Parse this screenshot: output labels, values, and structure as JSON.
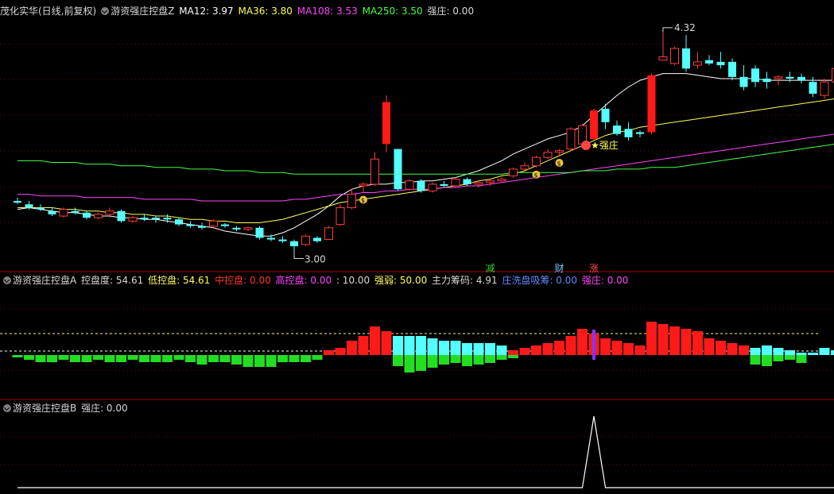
{
  "panel1": {
    "stock_title": "茂化实华(日线,前复权)",
    "indicator_name": "游资强庄控盘Z",
    "ma": [
      {
        "label": "MA12: 3.97",
        "color": "#ffffff"
      },
      {
        "label": "MA36: 3.80",
        "color": "#ffff55"
      },
      {
        "label": "MA108: 3.53",
        "color": "#ff44ff"
      },
      {
        "label": "MA250: 3.50",
        "color": "#44ff44"
      },
      {
        "label": "强庄: 0.00",
        "color": "#d8d8d8"
      }
    ],
    "high_label": "4.32",
    "low_label": "3.00",
    "star_label": "★强庄",
    "signals": [
      {
        "text": "减",
        "color": "#33cc33"
      },
      {
        "text": "财",
        "color": "#66ccff"
      },
      {
        "text": "涨",
        "color": "#ff4444"
      }
    ]
  },
  "panel2": {
    "indicator_name": "游资强庄控盘A",
    "items": [
      {
        "label": "控盘度: 54.61",
        "color": "#d8d8d8"
      },
      {
        "label": "低控盘: 54.61",
        "color": "#ffff55"
      },
      {
        "label": "中控盘: 0.00",
        "color": "#ff3333"
      },
      {
        "label": "高控盘: 0.00",
        "color": "#ff44ff"
      },
      {
        "label": ": 10.00",
        "color": "#d8d8d8"
      },
      {
        "label": "强弱: 50.00",
        "color": "#ffff55"
      },
      {
        "label": "主力筹码: 4.91",
        "color": "#d8d8d8"
      },
      {
        "label": "庄洗盘吸筹: 0.00",
        "color": "#6688ff"
      },
      {
        "label": "强庄: 0.00",
        "color": "#ff44ff"
      }
    ]
  },
  "panel3": {
    "indicator_name": "游资强庄控盘B",
    "items": [
      {
        "label": "强庄: 0.00",
        "color": "#d8d8d8"
      }
    ]
  },
  "chart_data": {
    "type": "candlestick",
    "price_range": [
      2.95,
      4.4
    ],
    "candles": [
      {
        "o": 3.31,
        "h": 3.33,
        "l": 3.29,
        "c": 3.3
      },
      {
        "o": 3.29,
        "h": 3.31,
        "l": 3.26,
        "c": 3.27
      },
      {
        "o": 3.27,
        "h": 3.29,
        "l": 3.25,
        "c": 3.26
      },
      {
        "o": 3.25,
        "h": 3.27,
        "l": 3.22,
        "c": 3.23
      },
      {
        "o": 3.22,
        "h": 3.27,
        "l": 3.21,
        "c": 3.26
      },
      {
        "o": 3.25,
        "h": 3.27,
        "l": 3.23,
        "c": 3.24
      },
      {
        "o": 3.24,
        "h": 3.25,
        "l": 3.2,
        "c": 3.21
      },
      {
        "o": 3.21,
        "h": 3.24,
        "l": 3.2,
        "c": 3.23
      },
      {
        "o": 3.23,
        "h": 3.27,
        "l": 3.21,
        "c": 3.25
      },
      {
        "o": 3.25,
        "h": 3.26,
        "l": 3.18,
        "c": 3.19
      },
      {
        "o": 3.19,
        "h": 3.22,
        "l": 3.18,
        "c": 3.21
      },
      {
        "o": 3.21,
        "h": 3.23,
        "l": 3.19,
        "c": 3.2
      },
      {
        "o": 3.21,
        "h": 3.22,
        "l": 3.18,
        "c": 3.2
      },
      {
        "o": 3.21,
        "h": 3.23,
        "l": 3.18,
        "c": 3.2
      },
      {
        "o": 3.2,
        "h": 3.21,
        "l": 3.16,
        "c": 3.17
      },
      {
        "o": 3.17,
        "h": 3.19,
        "l": 3.15,
        "c": 3.16
      },
      {
        "o": 3.16,
        "h": 3.18,
        "l": 3.14,
        "c": 3.15
      },
      {
        "o": 3.16,
        "h": 3.2,
        "l": 3.15,
        "c": 3.19
      },
      {
        "o": 3.17,
        "h": 3.18,
        "l": 3.15,
        "c": 3.16
      },
      {
        "o": 3.15,
        "h": 3.16,
        "l": 3.13,
        "c": 3.14
      },
      {
        "o": 3.14,
        "h": 3.16,
        "l": 3.13,
        "c": 3.15
      },
      {
        "o": 3.15,
        "h": 3.16,
        "l": 3.08,
        "c": 3.09
      },
      {
        "o": 3.09,
        "h": 3.11,
        "l": 3.07,
        "c": 3.08
      },
      {
        "o": 3.08,
        "h": 3.1,
        "l": 3.06,
        "c": 3.07
      },
      {
        "o": 3.07,
        "h": 3.08,
        "l": 3.0,
        "c": 3.04
      },
      {
        "o": 3.05,
        "h": 3.11,
        "l": 3.04,
        "c": 3.1
      },
      {
        "o": 3.09,
        "h": 3.1,
        "l": 3.06,
        "c": 3.07
      },
      {
        "o": 3.08,
        "h": 3.16,
        "l": 3.08,
        "c": 3.15
      },
      {
        "o": 3.17,
        "h": 3.29,
        "l": 3.16,
        "c": 3.27
      },
      {
        "o": 3.27,
        "h": 3.38,
        "l": 3.26,
        "c": 3.35
      },
      {
        "o": 3.4,
        "h": 3.42,
        "l": 3.36,
        "c": 3.41
      },
      {
        "o": 3.41,
        "h": 3.6,
        "l": 3.4,
        "c": 3.56
      },
      {
        "o": 3.65,
        "h": 3.94,
        "l": 3.6,
        "c": 3.9
      },
      {
        "o": 3.62,
        "h": 3.62,
        "l": 3.37,
        "c": 3.38
      },
      {
        "o": 3.38,
        "h": 3.44,
        "l": 3.37,
        "c": 3.43
      },
      {
        "o": 3.43,
        "h": 3.44,
        "l": 3.36,
        "c": 3.37
      },
      {
        "o": 3.37,
        "h": 3.42,
        "l": 3.36,
        "c": 3.41
      },
      {
        "o": 3.41,
        "h": 3.43,
        "l": 3.39,
        "c": 3.4
      },
      {
        "o": 3.4,
        "h": 3.45,
        "l": 3.39,
        "c": 3.44
      },
      {
        "o": 3.44,
        "h": 3.45,
        "l": 3.4,
        "c": 3.41
      },
      {
        "o": 3.41,
        "h": 3.43,
        "l": 3.39,
        "c": 3.42
      },
      {
        "o": 3.42,
        "h": 3.44,
        "l": 3.4,
        "c": 3.43
      },
      {
        "o": 3.43,
        "h": 3.45,
        "l": 3.42,
        "c": 3.44
      },
      {
        "o": 3.46,
        "h": 3.51,
        "l": 3.45,
        "c": 3.5
      },
      {
        "o": 3.5,
        "h": 3.54,
        "l": 3.49,
        "c": 3.52
      },
      {
        "o": 3.52,
        "h": 3.58,
        "l": 3.51,
        "c": 3.57
      },
      {
        "o": 3.57,
        "h": 3.62,
        "l": 3.56,
        "c": 3.6
      },
      {
        "o": 3.6,
        "h": 3.62,
        "l": 3.58,
        "c": 3.61
      },
      {
        "o": 3.62,
        "h": 3.75,
        "l": 3.61,
        "c": 3.74
      },
      {
        "o": 3.65,
        "h": 3.77,
        "l": 3.64,
        "c": 3.76
      },
      {
        "o": 3.68,
        "h": 3.86,
        "l": 3.67,
        "c": 3.85
      },
      {
        "o": 3.86,
        "h": 3.89,
        "l": 3.74,
        "c": 3.78
      },
      {
        "o": 3.76,
        "h": 3.79,
        "l": 3.7,
        "c": 3.71
      },
      {
        "o": 3.74,
        "h": 3.78,
        "l": 3.67,
        "c": 3.69
      },
      {
        "o": 3.72,
        "h": 3.73,
        "l": 3.69,
        "c": 3.71
      },
      {
        "o": 3.72,
        "h": 4.07,
        "l": 3.71,
        "c": 4.06
      },
      {
        "o": 4.15,
        "h": 4.32,
        "l": 4.15,
        "c": 4.17
      },
      {
        "o": 4.13,
        "h": 4.23,
        "l": 4.12,
        "c": 4.22
      },
      {
        "o": 4.22,
        "h": 4.3,
        "l": 4.08,
        "c": 4.1
      },
      {
        "o": 4.12,
        "h": 4.2,
        "l": 4.1,
        "c": 4.14
      },
      {
        "o": 4.15,
        "h": 4.18,
        "l": 4.12,
        "c": 4.13
      },
      {
        "o": 4.14,
        "h": 4.2,
        "l": 4.1,
        "c": 4.12
      },
      {
        "o": 4.14,
        "h": 4.16,
        "l": 4.03,
        "c": 4.05
      },
      {
        "o": 4.05,
        "h": 4.12,
        "l": 3.97,
        "c": 3.99
      },
      {
        "o": 4.1,
        "h": 4.12,
        "l": 3.99,
        "c": 4.02
      },
      {
        "o": 4.04,
        "h": 4.08,
        "l": 3.98,
        "c": 4.02
      },
      {
        "o": 4.04,
        "h": 4.06,
        "l": 4.0,
        "c": 4.05
      },
      {
        "o": 4.05,
        "h": 4.08,
        "l": 4.02,
        "c": 4.04
      },
      {
        "o": 4.05,
        "h": 4.07,
        "l": 4.01,
        "c": 4.03
      },
      {
        "o": 4.02,
        "h": 4.05,
        "l": 3.93,
        "c": 3.95
      },
      {
        "o": 3.94,
        "h": 4.04,
        "l": 3.92,
        "c": 4.02
      },
      {
        "o": 4.02,
        "h": 4.11,
        "l": 4.01,
        "c": 4.1
      },
      {
        "o": 4.04,
        "h": 4.11,
        "l": 4.01,
        "c": 4.1
      },
      {
        "o": 4.04,
        "h": 4.07,
        "l": 4.02,
        "c": 4.05
      },
      {
        "o": 4.05,
        "h": 4.09,
        "l": 4.03,
        "c": 4.08
      }
    ],
    "ma_lines": [
      {
        "name": "MA12",
        "color": "#ffffff",
        "values": [
          3.26,
          3.27,
          3.26,
          3.25,
          3.24,
          3.24,
          3.23,
          3.22,
          3.22,
          3.21,
          3.21,
          3.2,
          3.2,
          3.19,
          3.18,
          3.17,
          3.16,
          3.15,
          3.13,
          3.12,
          3.11,
          3.1,
          3.1,
          3.12,
          3.15,
          3.19,
          3.23,
          3.28,
          3.34,
          3.38,
          3.4,
          3.41,
          3.41,
          3.42,
          3.42,
          3.43,
          3.43,
          3.44,
          3.45,
          3.47,
          3.49,
          3.52,
          3.55,
          3.59,
          3.62,
          3.65,
          3.68,
          3.7,
          3.72,
          3.76,
          3.82,
          3.88,
          3.94,
          3.99,
          4.03,
          4.05,
          4.07,
          4.07,
          4.07,
          4.06,
          4.05,
          4.04,
          4.04,
          4.04,
          4.04,
          4.03,
          4.03,
          4.03,
          4.03,
          4.03,
          4.03,
          4.03,
          4.04
        ]
      },
      {
        "name": "MA36",
        "color": "#ffff55",
        "values": [
          3.27,
          3.27,
          3.27,
          3.27,
          3.26,
          3.26,
          3.25,
          3.25,
          3.24,
          3.24,
          3.23,
          3.23,
          3.22,
          3.22,
          3.21,
          3.2,
          3.2,
          3.19,
          3.19,
          3.18,
          3.18,
          3.18,
          3.19,
          3.2,
          3.22,
          3.24,
          3.26,
          3.28,
          3.3,
          3.31,
          3.32,
          3.33,
          3.34,
          3.35,
          3.36,
          3.37,
          3.38,
          3.39,
          3.4,
          3.41,
          3.43,
          3.44,
          3.46,
          3.47,
          3.49,
          3.52,
          3.55,
          3.58,
          3.61,
          3.64,
          3.67,
          3.7,
          3.72,
          3.73,
          3.75,
          3.76,
          3.77,
          3.78,
          3.79,
          3.8,
          3.81,
          3.82,
          3.83,
          3.84,
          3.85,
          3.86,
          3.87,
          3.88,
          3.89,
          3.9,
          3.91,
          3.92,
          3.93
        ]
      },
      {
        "name": "MA108",
        "color": "#ff44ff",
        "values": [
          3.35,
          3.35,
          3.34,
          3.34,
          3.34,
          3.34,
          3.33,
          3.33,
          3.33,
          3.33,
          3.33,
          3.32,
          3.32,
          3.32,
          3.32,
          3.32,
          3.31,
          3.31,
          3.31,
          3.31,
          3.31,
          3.31,
          3.31,
          3.31,
          3.32,
          3.32,
          3.33,
          3.34,
          3.35,
          3.35,
          3.36,
          3.36,
          3.37,
          3.37,
          3.38,
          3.38,
          3.38,
          3.39,
          3.39,
          3.4,
          3.4,
          3.41,
          3.42,
          3.43,
          3.44,
          3.45,
          3.46,
          3.47,
          3.48,
          3.49,
          3.5,
          3.51,
          3.52,
          3.53,
          3.54,
          3.55,
          3.56,
          3.57,
          3.58,
          3.59,
          3.6,
          3.61,
          3.62,
          3.63,
          3.64,
          3.65,
          3.66,
          3.67,
          3.68,
          3.69,
          3.7,
          3.71,
          3.72
        ]
      },
      {
        "name": "MA250",
        "color": "#44ff44",
        "values": [
          3.55,
          3.55,
          3.55,
          3.54,
          3.54,
          3.54,
          3.53,
          3.53,
          3.53,
          3.52,
          3.52,
          3.52,
          3.51,
          3.51,
          3.51,
          3.5,
          3.5,
          3.5,
          3.49,
          3.49,
          3.49,
          3.48,
          3.48,
          3.48,
          3.47,
          3.47,
          3.47,
          3.47,
          3.47,
          3.47,
          3.47,
          3.47,
          3.47,
          3.47,
          3.47,
          3.47,
          3.47,
          3.47,
          3.47,
          3.47,
          3.47,
          3.47,
          3.47,
          3.48,
          3.48,
          3.48,
          3.48,
          3.48,
          3.48,
          3.49,
          3.49,
          3.49,
          3.5,
          3.5,
          3.5,
          3.51,
          3.51,
          3.51,
          3.52,
          3.53,
          3.54,
          3.55,
          3.56,
          3.57,
          3.58,
          3.59,
          3.6,
          3.61,
          3.62,
          3.63,
          3.64,
          3.65,
          3.66
        ]
      }
    ],
    "control_bars": [
      -1,
      -2,
      -3,
      -3,
      -2,
      -3,
      -3,
      -2,
      -3,
      -3,
      -2,
      -3,
      -3,
      -3,
      -2,
      -3,
      -4,
      -3,
      -3,
      -4,
      -5,
      -5,
      -5,
      -3,
      -3,
      -3,
      -2,
      2,
      3,
      6,
      8,
      12,
      10,
      -8,
      -8,
      -8,
      -7,
      -6,
      -6,
      -5,
      -5,
      -5,
      -4,
      2,
      3,
      4,
      5,
      6,
      8,
      11,
      9,
      7,
      6,
      5,
      4,
      14,
      13,
      12,
      11,
      10,
      7,
      6,
      5,
      4,
      -3,
      -4,
      -3,
      -2,
      -1,
      -1,
      -3,
      -2,
      -2,
      3,
      4,
      3,
      3
    ],
    "control_marker_index": 50,
    "strong_spike_index": 50,
    "signals": [
      {
        "text": "减",
        "index": 41
      },
      {
        "text": "财",
        "index": 47
      },
      {
        "text": "涨",
        "index": 50
      }
    ]
  }
}
